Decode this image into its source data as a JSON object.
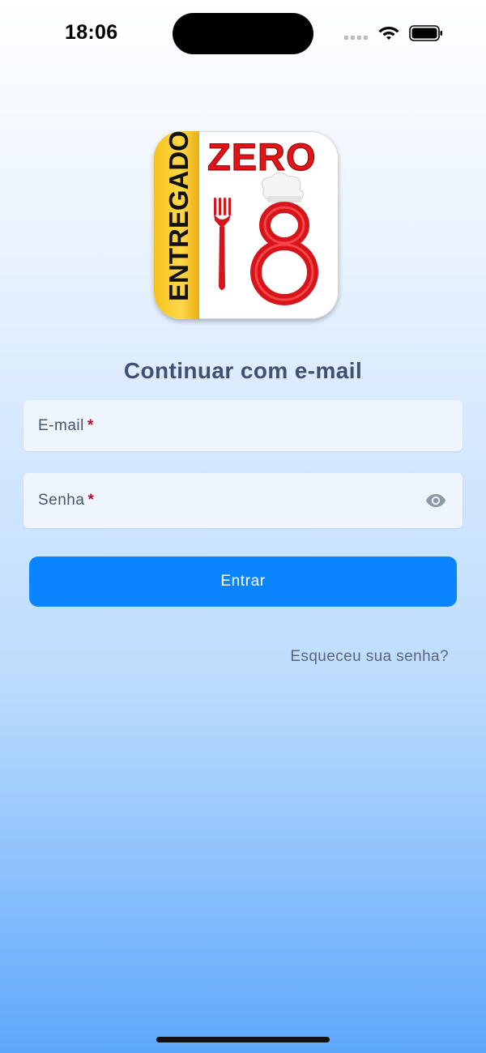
{
  "status_bar": {
    "time": "18:06"
  },
  "logo": {
    "side_text": "ENTREGADOR",
    "top_text": "ZERO",
    "number": "8"
  },
  "form": {
    "title": "Continuar com e-mail",
    "email_label": "E-mail",
    "password_label": "Senha",
    "required_mark": "*",
    "submit_label": "Entrar",
    "forgot_label": "Esqueceu sua senha?"
  },
  "colors": {
    "primary": "#0a84ff",
    "title": "#405070",
    "field_bg": "#eef5fe",
    "required": "#b0102a",
    "logo_red": "#e1141a",
    "logo_yellow": "#f7c21a"
  },
  "icons": {
    "wifi": "wifi-icon",
    "battery": "battery-icon",
    "signal": "cellular-signal-icon",
    "password_toggle": "eye-icon"
  }
}
